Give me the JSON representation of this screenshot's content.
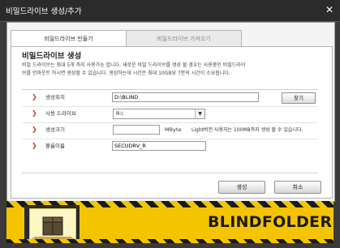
{
  "window": {
    "title": "비밀드라이브 생성/추가",
    "close_glyph": "✕"
  },
  "tabs": [
    {
      "label": "비밀드라이브 만들기",
      "active": true
    },
    {
      "label": "비밀드라이브 가져오기",
      "active": false
    }
  ],
  "section": {
    "title": "비밀드라이브 생성",
    "description": "비밀 드라이브는 최대 5개 까지 사용가능 합니다. 새로운 비밀 드라이브를 생성 할 경우는 사용중인 비밀드라이브를 언마운트 하시면 생성할 수 있습니다. 생성하는데 시간은 최대 10GB당 7분의 시간이 소요됩니다."
  },
  "form": {
    "location": {
      "label": "생성위치",
      "value": "D:\\BLIND",
      "button": "찾기"
    },
    "drive": {
      "label": "사용 드라이브",
      "value": "R:\\"
    },
    "size": {
      "label": "생성크기",
      "value": "",
      "unit": "MByte",
      "hint": "Light버전 사용자는 100MB까지 생성 할 수 있습니다."
    },
    "volume": {
      "label": "볼륨이름",
      "value": "SECUDRV_R"
    }
  },
  "buttons": {
    "create": "생성",
    "cancel": "취소"
  },
  "footer": {
    "brand": "BLINDFOLDER"
  },
  "colors": {
    "arrow": "#c0392b",
    "banner": "#f5c400",
    "titlebar": "#2b2b2b"
  }
}
